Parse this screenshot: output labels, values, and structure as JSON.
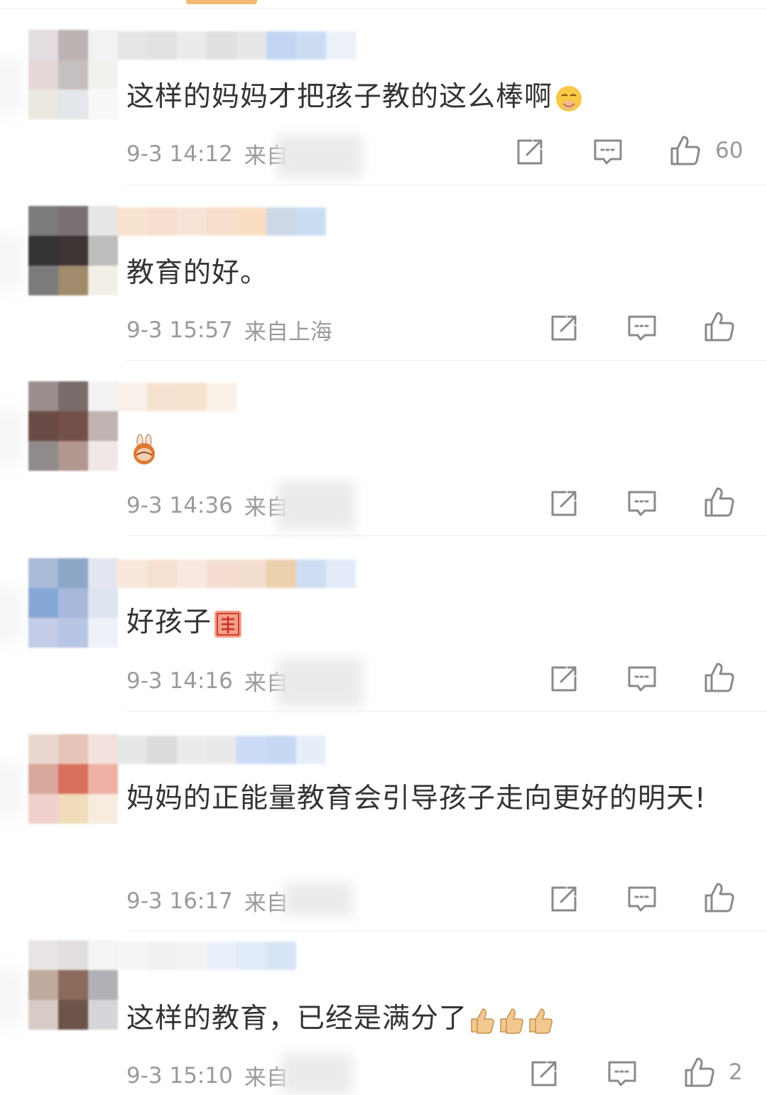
{
  "comments": [
    {
      "text": "这样的妈妈才把孩子教的这么棒啊",
      "emoji": "face-holding-back-tears",
      "time": "9-3 14:12",
      "source": "来自",
      "likes": "60",
      "avatar_colors": [
        "#e3dde1",
        "#bcb3b2",
        "#f3f2f2",
        "#e5d8d6",
        "#c6bfbf",
        "#f1f1ee",
        "#ebe8e0",
        "#e3e6ea",
        "#f8f8f8"
      ],
      "name_colors": [
        "#e1e1e1",
        "#dcdcdc",
        "#e8e8e8",
        "#dadada",
        "#e3e3e3",
        "#b8d0f0",
        "#c4d8f2",
        "#e8eef8"
      ]
    },
    {
      "text": "教育的好。",
      "emoji": "",
      "time": "9-3 15:57",
      "source": "来自上海",
      "likes": "",
      "avatar_colors": [
        "#7d7b7b",
        "#7a7272",
        "#e6e6e6",
        "#353333",
        "#3c3534",
        "#bfbcbc",
        "#7b7b7b",
        "#a08c6c",
        "#f2efe6"
      ],
      "name_colors": [
        "#f7ddc8",
        "#f5d9c6",
        "#f7e0d0",
        "#f6d8c4",
        "#f8d8b8",
        "#c6d2e4",
        "#c2d8f2"
      ]
    },
    {
      "text": "",
      "emoji": "bunny-hug",
      "time": "9-3 14:36",
      "source": "来自",
      "likes": "",
      "avatar_colors": [
        "#9a8e8c",
        "#7a6c6a",
        "#f2f2f2",
        "#6a4a46",
        "#74504a",
        "#c0b4b2",
        "#908a8a",
        "#b29690",
        "#f0e8e6"
      ],
      "name_colors": [
        "#f8eee6",
        "#f4dcc8",
        "#f6e0c8",
        "#faf0e4"
      ]
    },
    {
      "text": "好孩子",
      "emoji": "zan-stamp",
      "time": "9-3 14:16",
      "source": "来自",
      "likes": "",
      "avatar_colors": [
        "#a9bbd8",
        "#8ea6c8",
        "#e3e6f0",
        "#86a8d6",
        "#a8b8dc",
        "#dfe4f1",
        "#c3cbe6",
        "#b8c6e6",
        "#eef1f8"
      ],
      "name_colors": [
        "#f7e4d6",
        "#f5dcc8",
        "#f7e4dc",
        "#f3d8c8",
        "#f1d8c6",
        "#e8c8a0",
        "#c6d8f0",
        "#dde8f6"
      ]
    },
    {
      "text": "妈妈的正能量教育会引导孩子走向更好的明天!",
      "emoji": "",
      "time": "9-3 16:17",
      "source": "来自",
      "likes": "",
      "avatar_colors": [
        "#ead8d0",
        "#e8c4b8",
        "#f4e0dc",
        "#d8a89c",
        "#d8705c",
        "#eeb0a4",
        "#f0d0cc",
        "#f0dcb8",
        "#f8ece0"
      ],
      "name_colors": [
        "#e3e3e3",
        "#d6d6d6",
        "#e8e8e8",
        "#e6e6e6",
        "#c4d6f4",
        "#bed2f2",
        "#e2ecf8"
      ]
    },
    {
      "text": "这样的教育，已经是满分了",
      "emoji": "thumbs-up-x3",
      "time": "9-3 15:10",
      "source": "来自",
      "likes": "2",
      "avatar_colors": [
        "#e8e4e4",
        "#e2dede",
        "#f4f4f4",
        "#c0aa9e",
        "#8c6a5c",
        "#b0b0b6",
        "#d6cbc6",
        "#6c5448",
        "#d6d6da"
      ],
      "name_colors": [
        "#f4f4f4",
        "#eeeeee",
        "#f2f2f2",
        "#e6eefa",
        "#dce8f8",
        "#cfe0f4"
      ]
    }
  ],
  "icons": {
    "share": "share-icon",
    "comment": "comment-icon",
    "like": "thumbs-up-icon"
  },
  "colors": {
    "text": "#333333",
    "meta": "#9a9a9a",
    "icon": "#8a8a8a",
    "divider": "#ececec"
  }
}
